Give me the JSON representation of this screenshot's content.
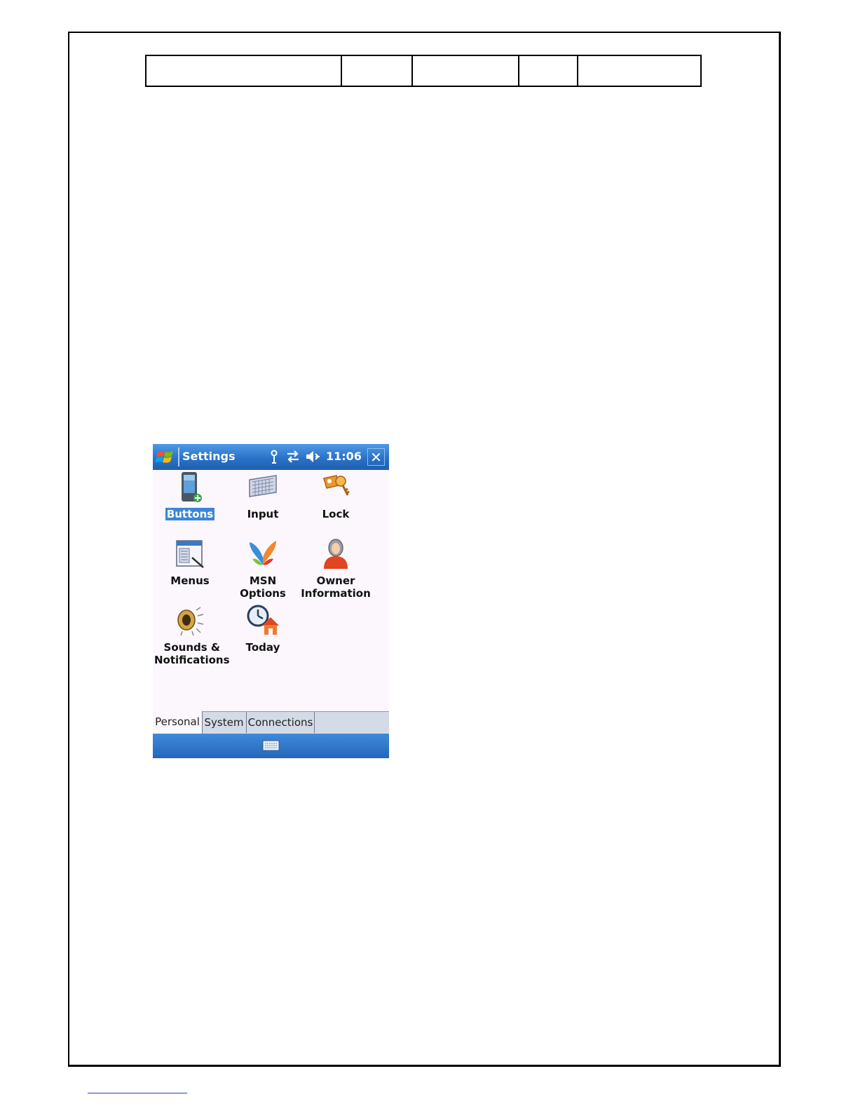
{
  "document": {
    "header_table_cells": [
      "",
      "",
      "",
      "",
      ""
    ]
  },
  "pda": {
    "title": "Settings",
    "clock": "11:06",
    "close_label": "✕",
    "status_icons": [
      "antenna-icon",
      "connectivity-arrows-icon",
      "speaker-muted-icon"
    ],
    "items": [
      {
        "label": "Buttons",
        "icon": "pda-button-icon",
        "selected": true
      },
      {
        "label": "Input",
        "icon": "keyboard-icon",
        "selected": false
      },
      {
        "label": "Lock",
        "icon": "key-lock-icon",
        "selected": false
      },
      {
        "label": "Menus",
        "icon": "menus-window-icon",
        "selected": false
      },
      {
        "label": "MSN Options",
        "icon": "msn-butterfly-icon",
        "selected": false
      },
      {
        "label_line1": "Owner",
        "label_line2": "Information",
        "icon": "owner-person-icon",
        "selected": false
      },
      {
        "label_line1": "Sounds &",
        "label_line2": "Notifications",
        "icon": "speaker-icon",
        "selected": false
      },
      {
        "label": "Today",
        "icon": "clock-house-icon",
        "selected": false
      }
    ],
    "tabs": [
      {
        "label": "Personal",
        "active": true
      },
      {
        "label": "System",
        "active": false
      },
      {
        "label": "Connections",
        "active": false
      }
    ],
    "sip_icon": "keyboard-sip-icon"
  }
}
